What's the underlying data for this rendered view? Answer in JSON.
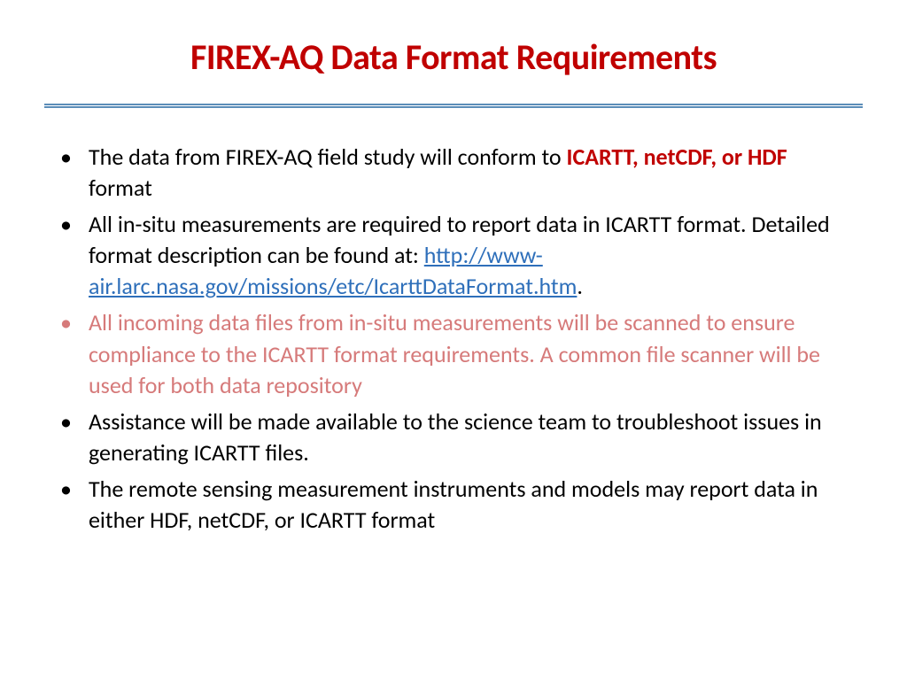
{
  "title": "FIREX-AQ Data Format Requirements",
  "bullets": [
    {
      "pre": "The data from FIREX-AQ field study will conform to ",
      "highlight": "ICARTT, netCDF, or HDF",
      "post": " format"
    },
    {
      "pre": "All in-situ measurements are required to report data in ICARTT format.  Detailed format description can be found at: ",
      "link": "http://www-air.larc.nasa.gov/missions/etc/IcarttDataFormat.htm",
      "post": "."
    },
    {
      "text": "All incoming data files from in-situ measurements will be scanned to ensure compliance to the ICARTT format requirements.  A common file scanner will be used for both data repository"
    },
    {
      "text": "Assistance will be made available to the science team to troubleshoot issues in generating ICARTT files."
    },
    {
      "text": "The remote sensing measurement instruments and models may report data in either HDF, netCDF, or ICARTT format"
    }
  ]
}
